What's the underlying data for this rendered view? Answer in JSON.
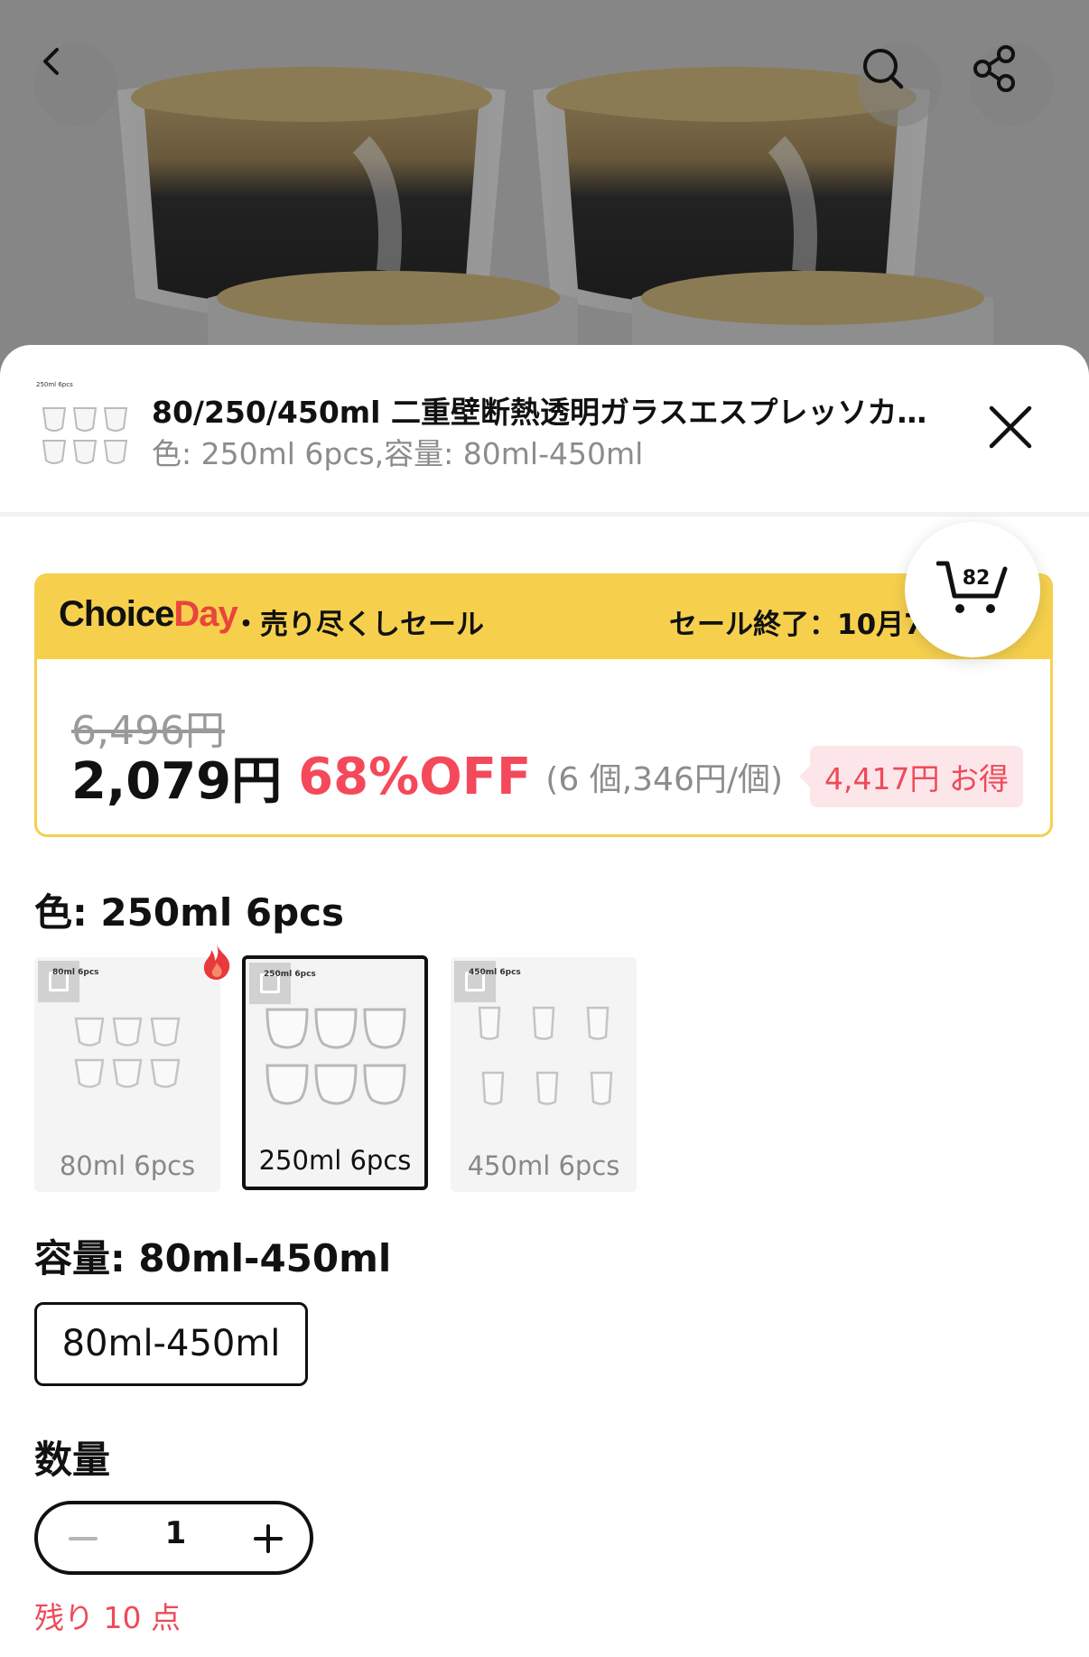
{
  "icons": {
    "back": "chevron-left-icon",
    "search": "search-icon",
    "share": "share-icon",
    "close": "close-icon",
    "cart": "cart-icon",
    "hot": "fire-icon",
    "minus": "minus-icon",
    "plus": "plus-icon"
  },
  "colors": {
    "accent_red": "#f4495a",
    "banner_yellow": "#f6d04d",
    "savings_bg": "#fde6ea"
  },
  "sheet": {
    "product_title": "80/250/450ml 二重壁断熱透明ガラスエスプレッソカ…",
    "variant_summary": "色: 250ml 6pcs,容量: 80ml-450ml",
    "thumb_label": "250ml 6pcs"
  },
  "cart": {
    "count": "82"
  },
  "sale": {
    "brand_choice": "Choice",
    "brand_day": "Day",
    "name": "・売り尽くしセール",
    "end_text": "セール終了：10月7",
    "original_price": "6,496円",
    "current_price": "2,079円",
    "discount": "68%OFF",
    "unit_price": "(6 個,346円/個)",
    "savings": "4,417円 お得"
  },
  "color": {
    "title": "色: 250ml 6pcs",
    "options": [
      {
        "label": "80ml 6pcs",
        "tiny": "80ml 6pcs",
        "selected": false,
        "hot": true
      },
      {
        "label": "250ml 6pcs",
        "tiny": "250ml 6pcs",
        "selected": true,
        "hot": false
      },
      {
        "label": "450ml 6pcs",
        "tiny": "450ml 6pcs",
        "selected": false,
        "hot": false
      }
    ]
  },
  "capacity": {
    "title": "容量: 80ml-450ml",
    "option": "80ml-450ml"
  },
  "quantity": {
    "title": "数量",
    "value": "1",
    "stock_text": "残り 10 点"
  }
}
